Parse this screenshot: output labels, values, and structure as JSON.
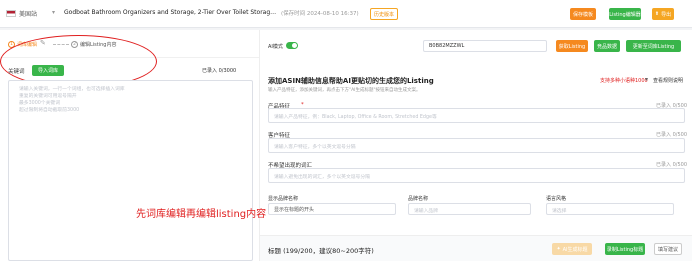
{
  "topbar": {
    "market": "美国站",
    "product_title": "Godboat Bathroom Organizers and Storage, 2-Tier Over Toilet Storage, Bathroo...",
    "saved_time": "(保存时间 2024-08-10 16:37)",
    "history_label": "历史版本",
    "save_template_label": "保存模板",
    "listing_edit_label": "Listing编辑器",
    "export_label": "导出"
  },
  "steps": [
    {
      "number": "1",
      "label": "词库编辑"
    },
    {
      "number": "2",
      "label": "编辑Listing内容"
    }
  ],
  "left": {
    "keyword_label": "关键词",
    "import_label": "导入词库",
    "count": "已录入 0/3000",
    "placeholder_lines": [
      "请输入关键词，一行一个词组，也可选择插入词库",
      "重复的关键词可用逗号隔开",
      "最多3000个关键词",
      "超过限制将自动截取前3000"
    ]
  },
  "right": {
    "ai_label": "AI模式",
    "asin_value": "B0B82MZZWL",
    "get_listing_label": "获取Listing",
    "competitor_label": "竞品数据",
    "update_label": "更新至词库Listing",
    "section_title": "添加ASIN辅助信息帮助AI更贴切的生成您的Listing",
    "section_hint": "输入产品特征，添加关键词，再点击下方\"AI生成标题\"按钮来自动生成文案。",
    "lang_select": "支持多种小语种1000",
    "rules_link": "查看规则说明",
    "product_feature_label": "产品特征",
    "product_feature_count": "已录入 0/500",
    "product_feature_placeholder": "请输入产品特征，例：Black, Laptop, Office & Room, Stretched Edge等",
    "customer_feature_label": "客户特征",
    "customer_feature_count": "已录入 0/500",
    "customer_feature_placeholder": "请输入客户特征，多个以英文逗号分隔",
    "avoid_label": "不希望出现的词汇",
    "avoid_count": "已录入 0/500",
    "avoid_placeholder": "请输入避免出现的词汇，多个以英文逗号分隔",
    "brand_display_label": "显示品牌名称",
    "brand_display_value": "显示在标题的开头",
    "brand_name_label": "品牌名称",
    "brand_name_placeholder": "请输入品牌",
    "style_label": "语言风格",
    "style_placeholder": "请选择",
    "title_heading": "标题 (199/200，建议80~200字符)",
    "ai_title_label": "AI生成标题",
    "record_title_label": "录制Listing标题",
    "advice_label": "填写建议"
  },
  "annotation": "先词库编辑再编辑listing内容",
  "colors": {
    "accent": "#f5891f",
    "green": "#39b54a",
    "annotation": "#e02020"
  }
}
